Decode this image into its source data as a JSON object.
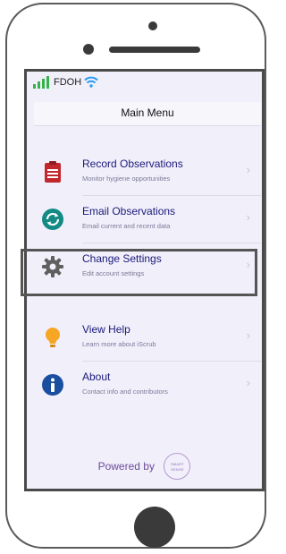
{
  "status": {
    "carrier": "FDOH",
    "signal_icon": "signal-bars-icon",
    "wifi_icon": "wifi-icon"
  },
  "nav": {
    "title": "Main Menu"
  },
  "menu": [
    {
      "title": "Record Observations",
      "subtitle": "Monitor hygiene opportunities",
      "icon": "clipboard-icon",
      "color": "#c0282d"
    },
    {
      "title": "Email Observations",
      "subtitle": "Email current and recent data",
      "icon": "sync-icon",
      "color": "#138a84"
    },
    {
      "title": "Change Settings",
      "subtitle": "Edit account settings",
      "icon": "gear-icon",
      "color": "#606060",
      "highlighted": true
    },
    {
      "title": "View Help",
      "subtitle": "Learn more about iScrub",
      "icon": "lightbulb-icon",
      "color": "#f5a623"
    },
    {
      "title": "About",
      "subtitle": "Contact info and contributors",
      "icon": "info-icon",
      "color": "#1a4fa0"
    }
  ],
  "footer": {
    "powered_by": "Powered by",
    "badge_top": "SMART",
    "badge_bottom": "SENSE"
  },
  "colors": {
    "accent": "#6b4a9b",
    "title_text": "#1a1a7a",
    "signal": "#37b24d",
    "wifi": "#2a9df4"
  }
}
